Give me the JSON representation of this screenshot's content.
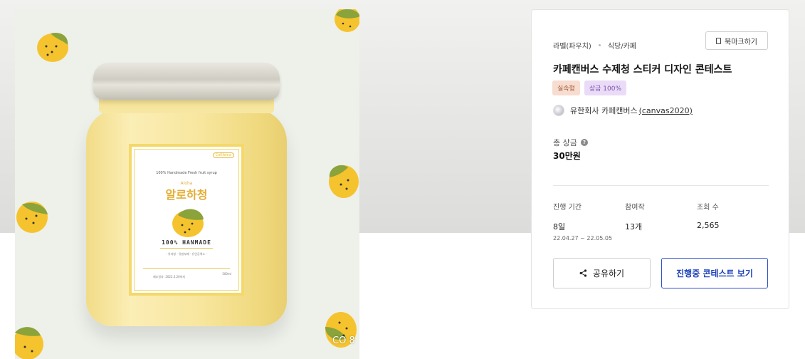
{
  "hero": {
    "jar_label": {
      "brand": "CoKfeina",
      "subtitle": "100% Handmade Fresh fruit syrup",
      "small": "Aloha",
      "title": "알로하청",
      "made": "100% HANMADE",
      "ingredients": "- 유자청 - 유방부제 - 유인공색소 -",
      "date": "제조일자: 2022.3.20까지",
      "volume": "500ml"
    },
    "corner_badge": "CO 8"
  },
  "card": {
    "crumbs": [
      "라벨(파우치)",
      "식당/카페"
    ],
    "bookmark_label": "북마크하기",
    "title": "카페캔버스 수제청 스티커 디자인 콘테스트",
    "tags": [
      "실속형",
      "상금 100%"
    ],
    "host": {
      "name": "유한회사 카페캔버스",
      "handle": "(canvas2020)"
    },
    "prize": {
      "label": "총 상금",
      "value": "30만원"
    },
    "stats": {
      "period": {
        "label": "진행 기간",
        "value": "8일",
        "range": "22.04.27 ~ 22.05.05"
      },
      "participants": {
        "label": "참여작",
        "value": "13개"
      },
      "views": {
        "label": "조회 수",
        "value": "2,565"
      }
    },
    "share_label": "공유하기",
    "view_label": "진행중 콘테스트 보기"
  }
}
